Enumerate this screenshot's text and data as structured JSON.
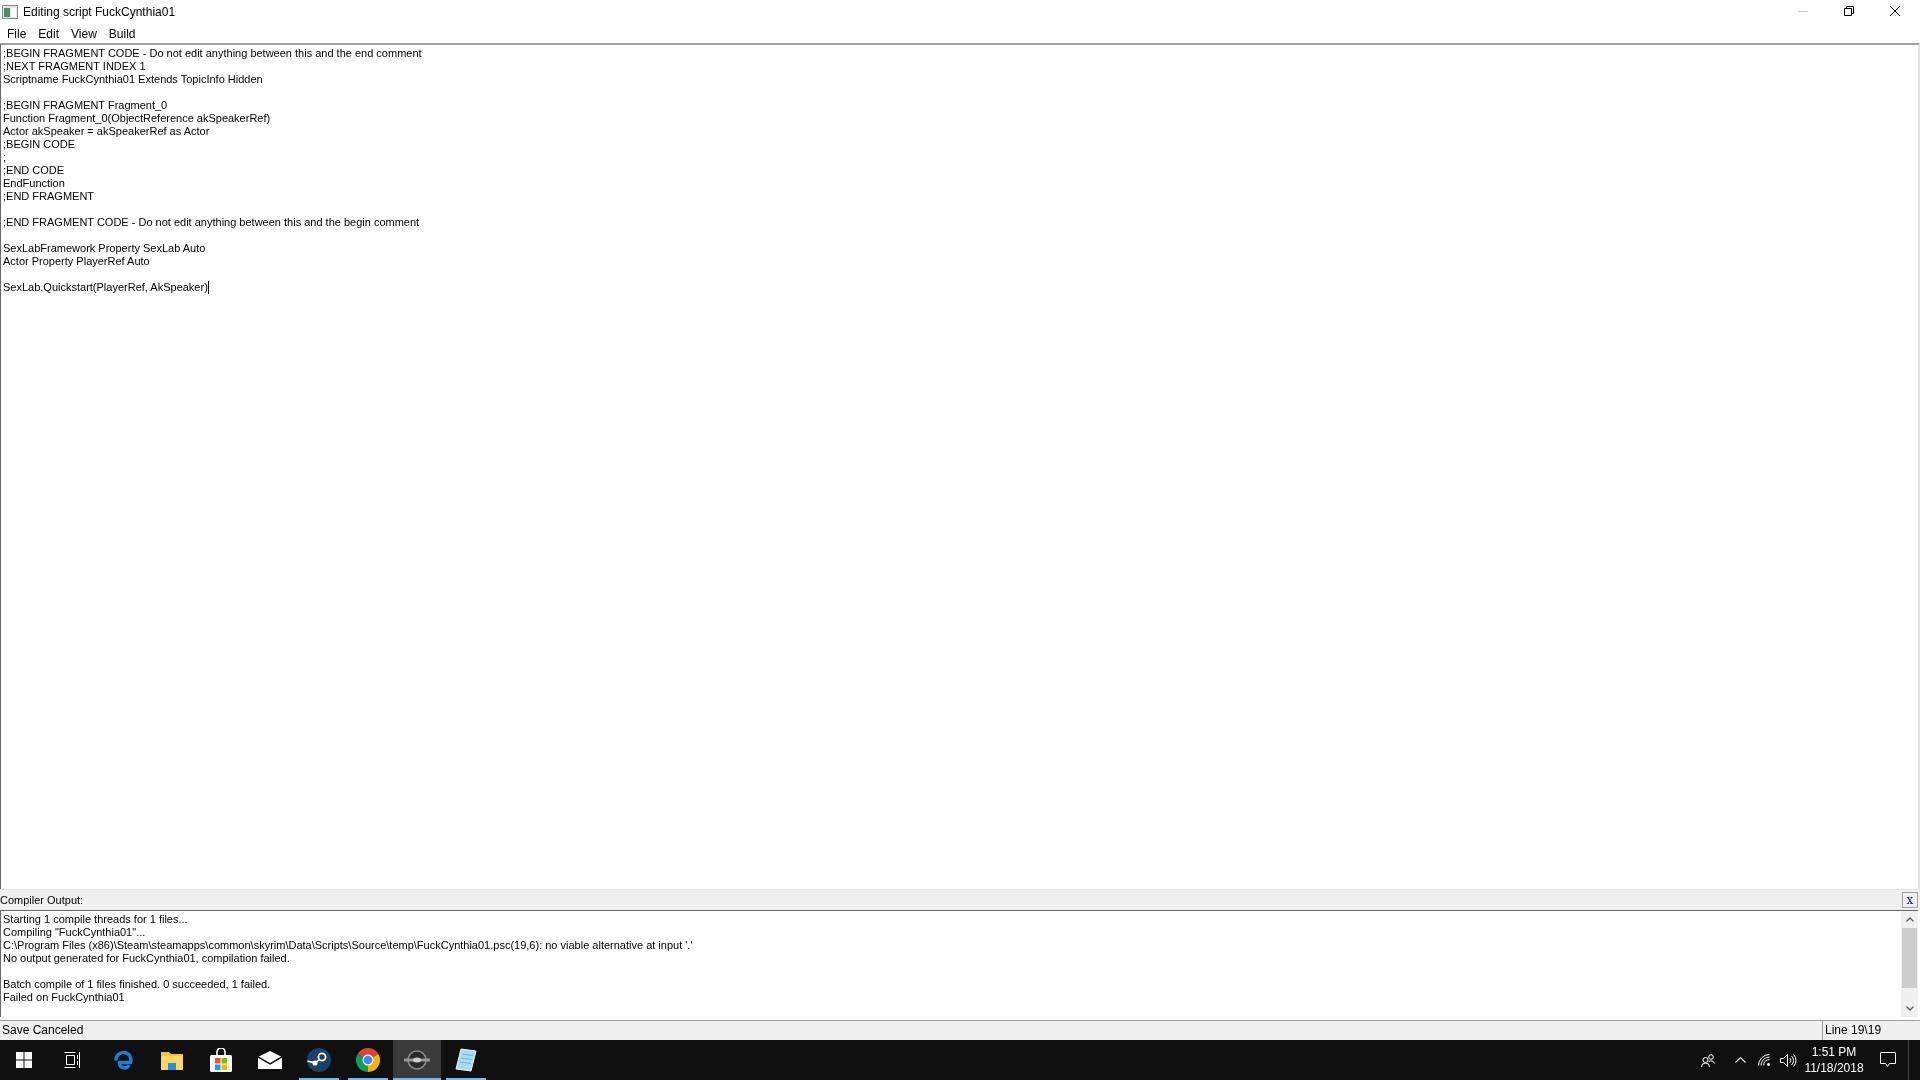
{
  "window": {
    "title": "Editing script FuckCynthia01",
    "controls": [
      {
        "kind": "minimize",
        "disabled": true
      },
      {
        "kind": "restore",
        "disabled": false
      },
      {
        "kind": "close",
        "disabled": false
      }
    ]
  },
  "menu": [
    "File",
    "Edit",
    "View",
    "Build"
  ],
  "editor": {
    "blocks": [
      [
        ";BEGIN FRAGMENT CODE - Do not edit anything between this and the end comment",
        ";NEXT FRAGMENT INDEX 1",
        "Scriptname FuckCynthia01 Extends TopicInfo Hidden"
      ],
      [
        ";BEGIN FRAGMENT Fragment_0",
        "Function Fragment_0(ObjectReference akSpeakerRef)",
        "Actor akSpeaker = akSpeakerRef as Actor",
        ";BEGIN CODE",
        ";",
        ";END CODE",
        "EndFunction",
        ";END FRAGMENT"
      ],
      [
        ";END FRAGMENT CODE - Do not edit anything between this and the begin comment"
      ],
      [
        "SexLabFramework Property SexLab Auto",
        "Actor Property PlayerRef Auto"
      ],
      [
        "SexLab.Quickstart(PlayerRef, AkSpeaker)"
      ]
    ]
  },
  "compiler_output": {
    "title": "Compiler Output:",
    "close_label": "x",
    "blocks": [
      [
        "Starting 1 compile threads for 1 files...",
        "Compiling \"FuckCynthia01\"...",
        "C:\\Program Files (x86)\\Steam\\steamapps\\common\\skyrim\\Data\\Scripts\\Source\\temp\\FuckCynthia01.psc(19,6): no viable alternative at input '.'",
        "No output generated for FuckCynthia01, compilation failed."
      ],
      [
        "Batch compile of 1 files finished. 0 succeeded, 1 failed.",
        "Failed on FuckCynthia01"
      ]
    ]
  },
  "status_bar": {
    "message": "Save Canceled",
    "position": "Line 19\\19"
  },
  "taskbar": {
    "apps": [
      {
        "running": false,
        "selected": false
      },
      {
        "running": false,
        "selected": false
      },
      {
        "running": false,
        "selected": false
      },
      {
        "running": false,
        "selected": false
      },
      {
        "running": true,
        "selected": false
      },
      {
        "running": true,
        "selected": false
      },
      {
        "running": true,
        "selected": true
      },
      {
        "running": true,
        "selected": false
      }
    ],
    "clock": {
      "time": "1:51 PM",
      "date": "11/18/2018"
    }
  }
}
